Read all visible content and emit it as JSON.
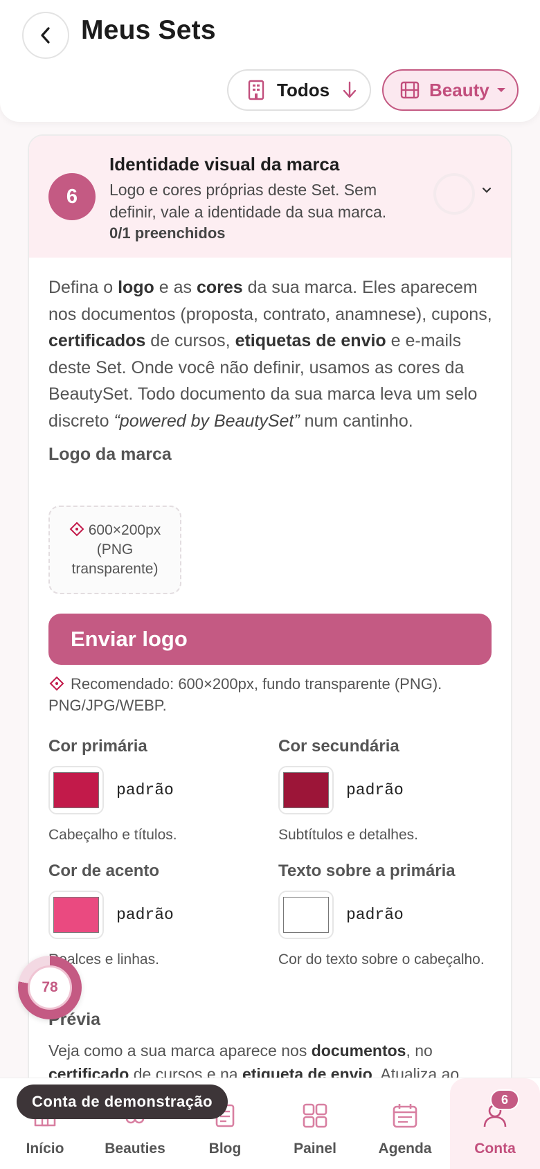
{
  "header": {
    "title": "Meus Sets",
    "filters": {
      "todos_label": "Todos",
      "beauty_label": "Beauty"
    }
  },
  "section": {
    "step": "6",
    "title": "Identidade visual da marca",
    "description": "Logo e cores próprias deste Set. Sem definir, vale a identidade da sua marca.",
    "count": "0/1 preenchidos",
    "intro": {
      "p1": "Defina o ",
      "b1": "logo",
      "p2": " e as ",
      "b2": "cores",
      "p3": " da sua marca. Eles aparecem nos documentos (proposta, contrato, anamnese), cupons, ",
      "b3": "certificados",
      "p4": " de cursos, ",
      "b4": "etiquetas de envio",
      "p5": " e e-mails deste Set. Onde você não definir, usamos as cores da BeautySet. Todo documento da sua marca leva um selo discreto ",
      "i1": "“powered by BeautySet”",
      "p6": " num cantinho."
    },
    "logo": {
      "label": "Logo da marca",
      "placeholder": "600×200px (PNG transparente)",
      "upload_label": "Enviar logo",
      "hint": "Recomendado: 600×200px, fundo transparente (PNG). PNG/JPG/WEBP."
    },
    "colors": [
      {
        "label": "Cor primária",
        "value": "padrão",
        "help": "Cabeçalho e títulos.",
        "color": "#c21a4a"
      },
      {
        "label": "Cor secundária",
        "value": "padrão",
        "help": "Subtítulos e detalhes.",
        "color": "#9c1538"
      },
      {
        "label": "Cor de acento",
        "value": "padrão",
        "help": "Realces e linhas.",
        "color": "#ea4a80"
      },
      {
        "label": "Texto sobre a primária",
        "value": "padrão",
        "help": "Cor do texto sobre o cabeçalho.",
        "color": "#ffffff"
      }
    ],
    "preview": {
      "label": "Prévia",
      "p1": "Veja como a sua marca aparece nos ",
      "b1": "documentos",
      "p2": ", no ",
      "b2": "certificado",
      "p3": " de cursos e na ",
      "b3": "etiqueta de envio",
      "p4": ". Atualiza ao"
    }
  },
  "score": "78",
  "demo_label": "Conta de demonstração",
  "nav": {
    "items": [
      {
        "label": "Início",
        "icon": "home-icon"
      },
      {
        "label": "Beauties",
        "icon": "beauties-icon"
      },
      {
        "label": "Blog",
        "icon": "blog-icon"
      },
      {
        "label": "Painel",
        "icon": "grid-icon"
      },
      {
        "label": "Agenda",
        "icon": "calendar-icon"
      },
      {
        "label": "Conta",
        "icon": "user-icon"
      }
    ],
    "badge": "6"
  },
  "theme": {
    "accent": "#c45a83",
    "accent_soft": "#fdeef2"
  }
}
